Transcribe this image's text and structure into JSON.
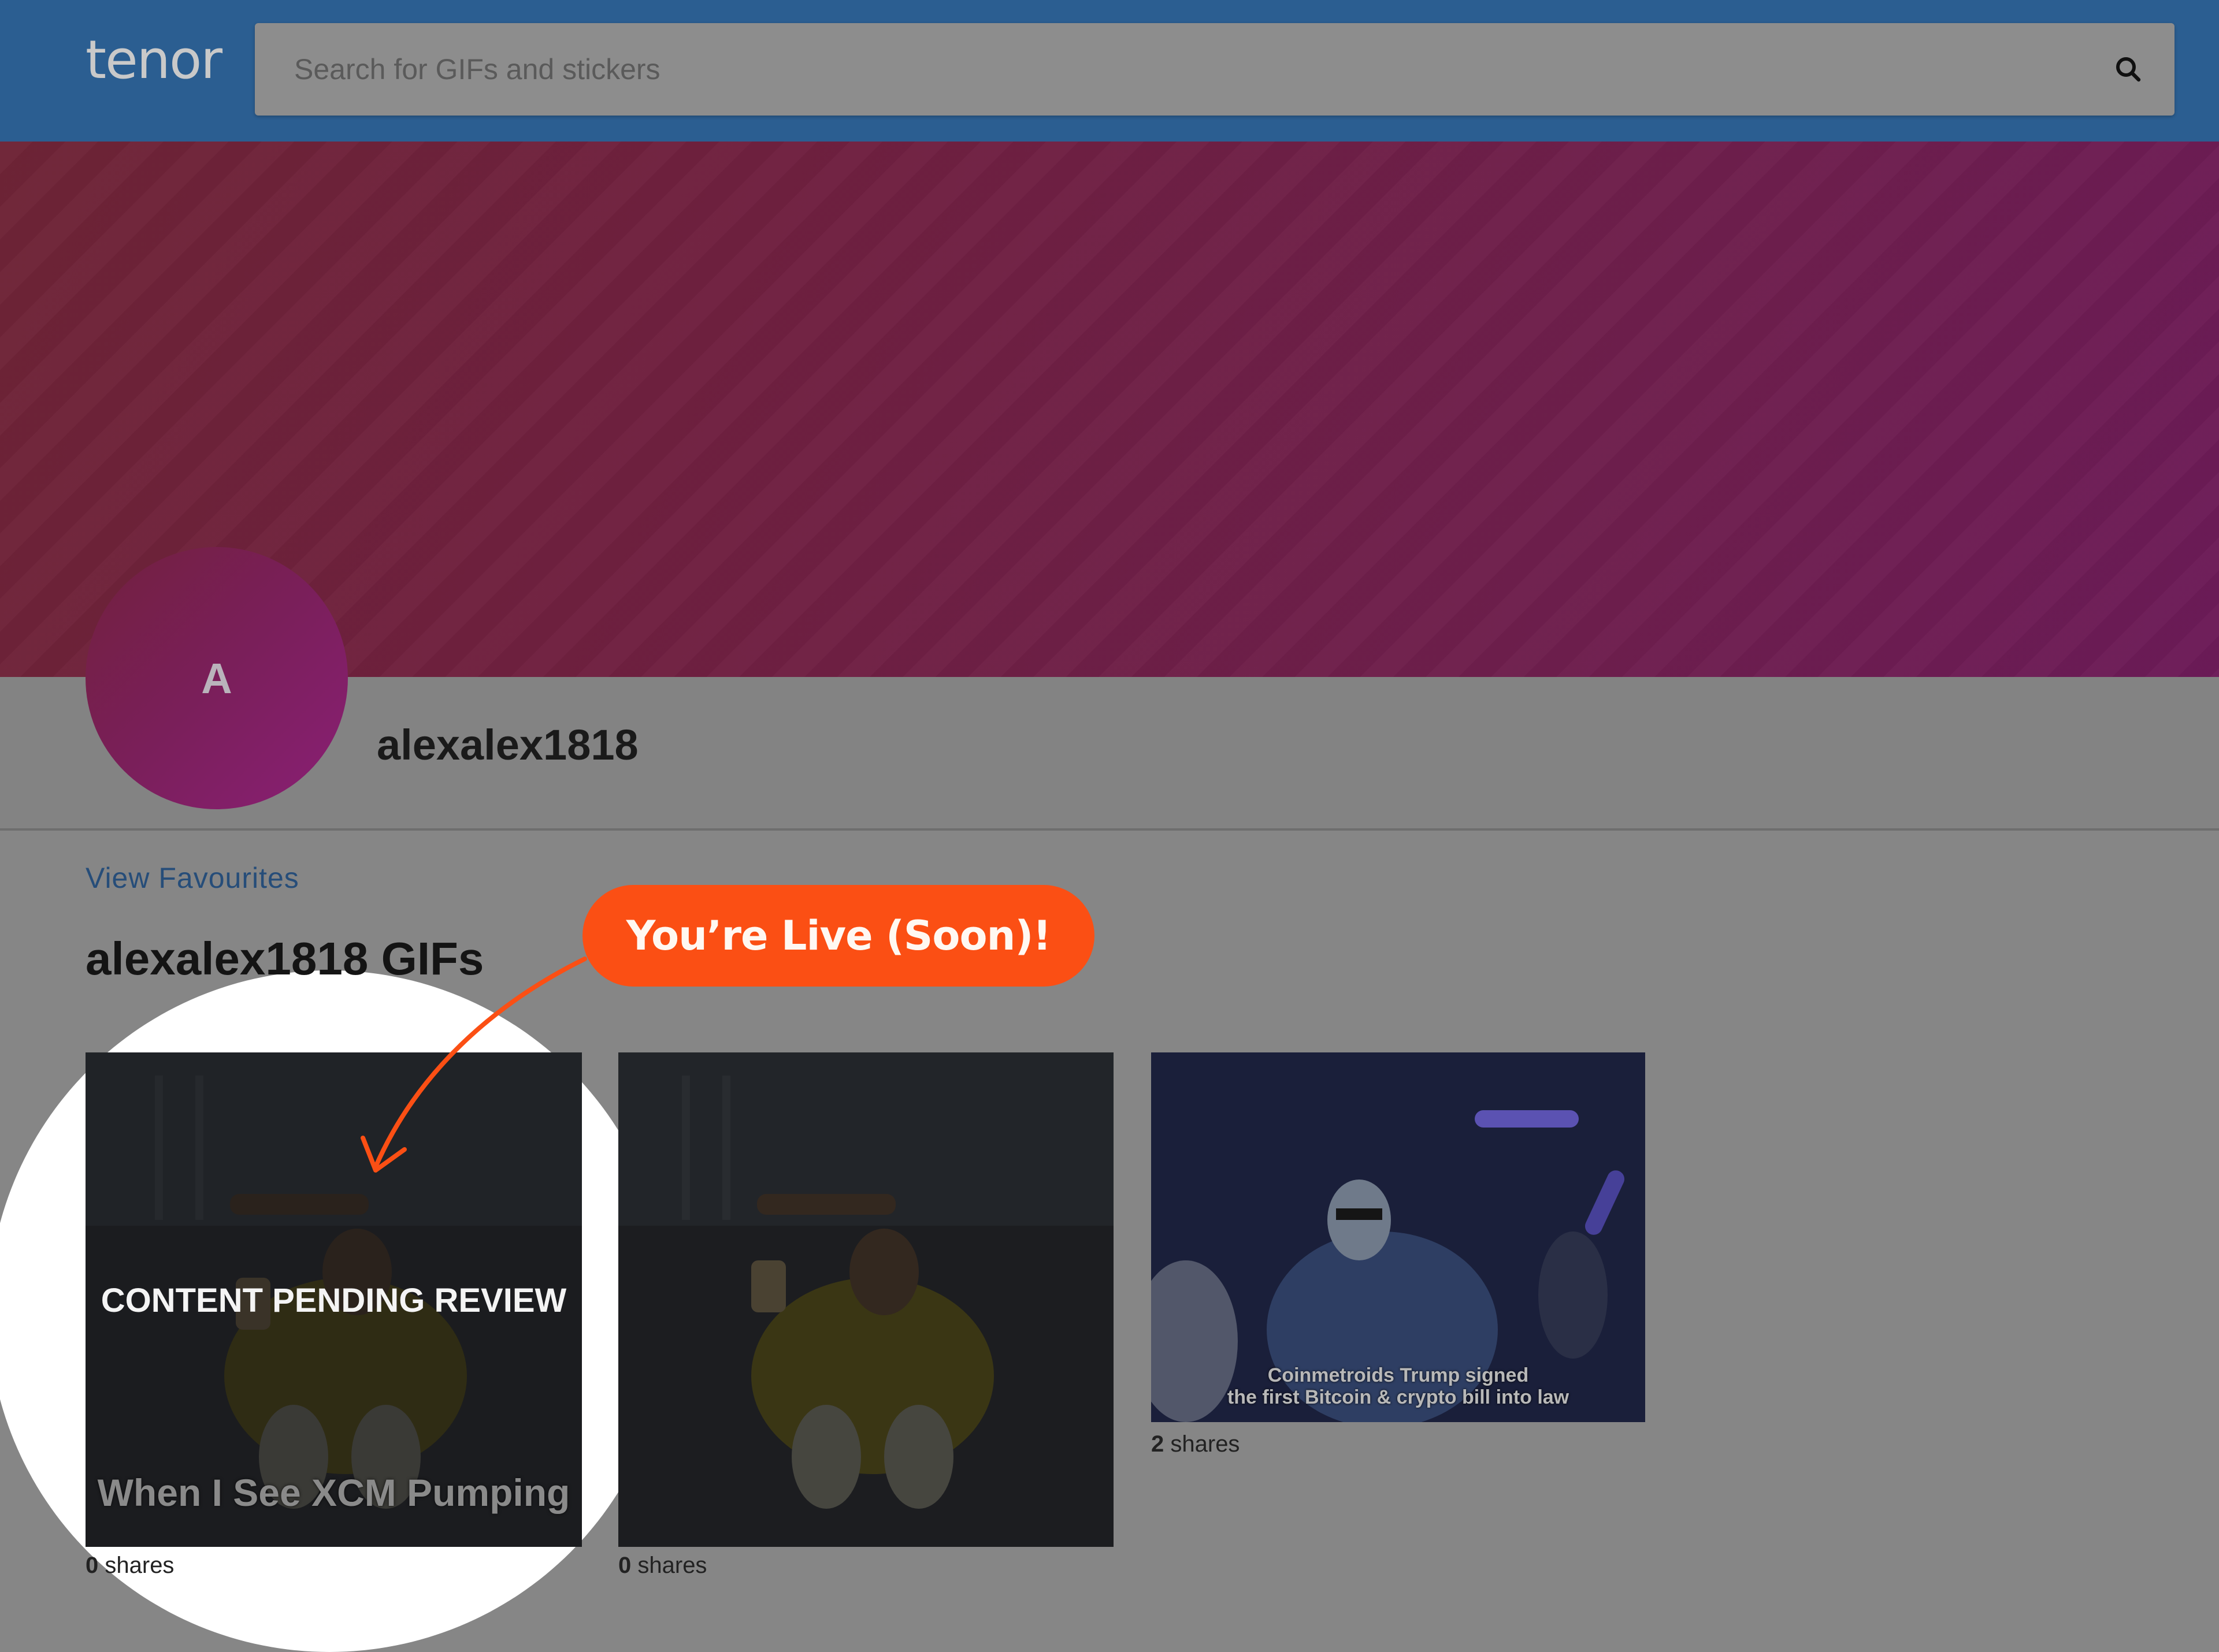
{
  "header": {
    "logo": "tenor",
    "search": {
      "placeholder": "Search for GIFs and stickers",
      "value": ""
    },
    "search_icon": "search-icon"
  },
  "profile": {
    "avatar_initial": "A",
    "username": "alexalex1818"
  },
  "content": {
    "view_favourites": "View Favourites",
    "section_title": "alexalex1818 GIFs",
    "callout": "You’re Live (Soon)!",
    "gifs": [
      {
        "overlay": "CONTENT PENDING REVIEW",
        "caption": "When I See XCM Pumping",
        "shares_count": "0",
        "shares_label": "shares"
      },
      {
        "overlay": "",
        "caption": "",
        "shares_count": "0",
        "shares_label": "shares"
      },
      {
        "overlay": "",
        "caption_line1": "Coinmetroids Trump signed",
        "caption_line2": "the first Bitcoin & crypto bill into law",
        "shares_count": "2",
        "shares_label": "shares"
      }
    ]
  },
  "colors": {
    "header_bg": "#2b5e91",
    "callout_bg": "#fb4f14",
    "link": "#264d79",
    "page_bg": "#868686"
  }
}
